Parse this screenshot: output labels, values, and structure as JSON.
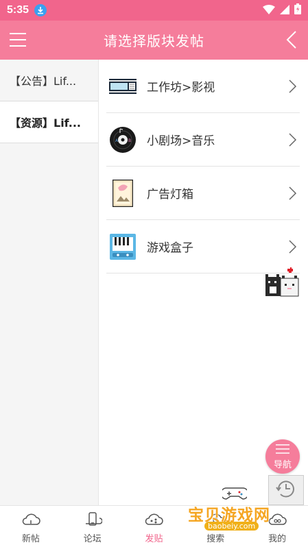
{
  "status_bar": {
    "time": "5:35"
  },
  "header": {
    "title": "请选择版块发帖"
  },
  "sidebar": {
    "items": [
      {
        "label": "【公告】Lif..."
      },
      {
        "label": "【资源】Lif..."
      }
    ]
  },
  "boards": [
    {
      "label": "工作坊>影视",
      "icon": "film-strip-icon"
    },
    {
      "label": "小剧场>音乐",
      "icon": "music-disc-icon"
    },
    {
      "label": "广告灯箱",
      "icon": "poster-frame-icon"
    },
    {
      "label": "游戏盒子",
      "icon": "piano-box-icon"
    }
  ],
  "fab": {
    "label": "导航"
  },
  "tabs": [
    {
      "label": "新帖"
    },
    {
      "label": "论坛"
    },
    {
      "label": "发贴"
    },
    {
      "label": "搜索"
    },
    {
      "label": "我的"
    }
  ],
  "watermark": {
    "text": "宝贝游戏网",
    "url": "baobeiy.com"
  },
  "colors": {
    "accent": "#f57d9b",
    "status_bar": "#f1658c",
    "active_tab": "#f1658c"
  }
}
